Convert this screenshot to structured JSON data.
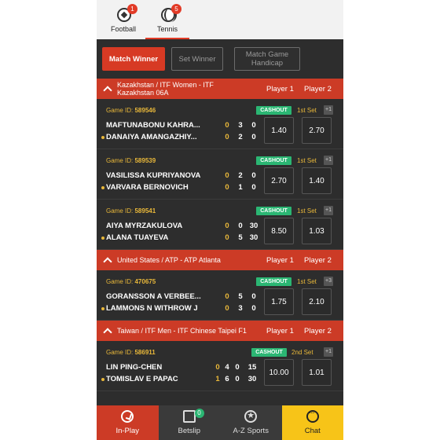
{
  "sport_tabs": [
    {
      "label": "Football",
      "badge": "1",
      "icon": "football-icon"
    },
    {
      "label": "Tennis",
      "badge": "5",
      "icon": "tennis-ball-icon"
    }
  ],
  "markets": {
    "match_winner": "Match Winner",
    "set_winner": "Set Winner",
    "match_game_handicap": "Match Game Handicap"
  },
  "column_headers": {
    "player1": "Player 1",
    "player2": "Player 2"
  },
  "leagues": [
    {
      "name": "Kazakhstan / ITF Women - ITF Kazakhstan 06A",
      "matches": [
        {
          "game_id_label": "Game ID:",
          "game_id": "589546",
          "cashout": "CASHOUT",
          "set": "1st Set",
          "more": "+1",
          "p1": "MAFTUNABONU KAHRA...",
          "p2": "DANAIYA AMANGAZHIY...",
          "p1_scores": [
            "0",
            "3",
            "0"
          ],
          "p2_scores": [
            "0",
            "2",
            "0"
          ],
          "odd1": "1.40",
          "odd2": "2.70"
        },
        {
          "game_id_label": "Game ID:",
          "game_id": "589539",
          "cashout": "CASHOUT",
          "set": "1st Set",
          "more": "+1",
          "p1": "VASILISSA KUPRIYANOVA",
          "p2": "VARVARA BERNOVICH",
          "p1_scores": [
            "0",
            "2",
            "0"
          ],
          "p2_scores": [
            "0",
            "1",
            "0"
          ],
          "odd1": "2.70",
          "odd2": "1.40"
        },
        {
          "game_id_label": "Game ID:",
          "game_id": "589541",
          "cashout": "CASHOUT",
          "set": "1st Set",
          "more": "+1",
          "p1": "AIYA MYRZAKULOVA",
          "p2": "ALANA TUAYEVA",
          "p1_scores": [
            "0",
            "0",
            "30"
          ],
          "p2_scores": [
            "0",
            "5",
            "30"
          ],
          "odd1": "8.50",
          "odd2": "1.03"
        }
      ]
    },
    {
      "name": "United States / ATP - ATP Atlanta",
      "matches": [
        {
          "game_id_label": "Game ID:",
          "game_id": "470675",
          "cashout": "CASHOUT",
          "set": "1st Set",
          "more": "+3",
          "p1": "GORANSSON A VERBEE...",
          "p2": "LAMMONS N WITHROW J",
          "p1_scores": [
            "0",
            "5",
            "0"
          ],
          "p2_scores": [
            "0",
            "3",
            "0"
          ],
          "odd1": "1.75",
          "odd2": "2.10"
        }
      ]
    },
    {
      "name": "Taiwan / ITF Men - ITF Chinese Taipei F1",
      "matches": [
        {
          "game_id_label": "Game ID:",
          "game_id": "586911",
          "cashout": "CASHOUT",
          "set": "2nd Set",
          "more": "+1",
          "p1": "LIN PING-CHEN",
          "p2": "TOMISLAV E PAPAC",
          "p1_scores": [
            "0",
            "4",
            "0",
            "15"
          ],
          "p2_scores": [
            "1",
            "6",
            "0",
            "30"
          ],
          "odd1": "10.00",
          "odd2": "1.01"
        }
      ]
    }
  ],
  "bottom_nav": {
    "inplay": "In-Play",
    "betslip": "Betslip",
    "betslip_badge": "0",
    "az": "A-Z Sports",
    "chat": "Chat"
  },
  "colors": {
    "accent": "#cc3b26",
    "chat": "#f7c418",
    "cashout": "#2bb673",
    "highlight": "#e9b83a"
  }
}
